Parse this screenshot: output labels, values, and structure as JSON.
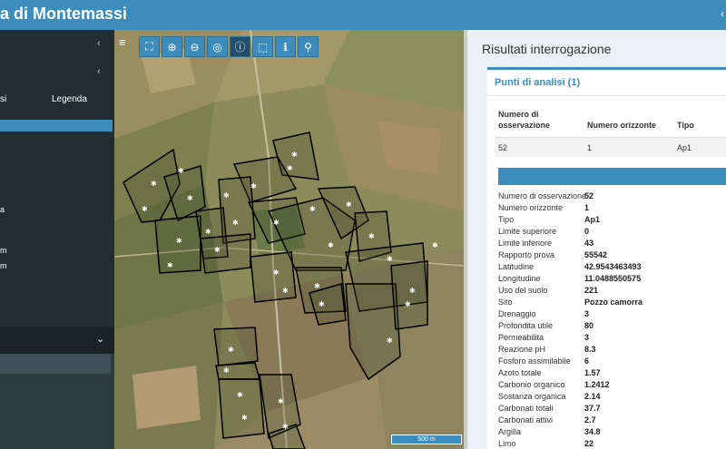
{
  "header": {
    "title": "a di Montemassi",
    "ctrl": "‹"
  },
  "sidebar": {
    "tab_left": "si",
    "tab_right": "Legenda",
    "items": [
      "a",
      "m",
      "m"
    ]
  },
  "toolbar": {
    "menu_icon": "hamburger-icon",
    "tools": [
      {
        "name": "fullscreen-icon",
        "glyph": "⛶"
      },
      {
        "name": "zoom-in-icon",
        "glyph": "⊕"
      },
      {
        "name": "zoom-out-icon",
        "glyph": "⊖"
      },
      {
        "name": "zoom-extent-icon",
        "glyph": "◎"
      },
      {
        "name": "info-icon",
        "glyph": "ⓘ"
      },
      {
        "name": "select-box-icon",
        "glyph": "⬚"
      },
      {
        "name": "identify-icon",
        "glyph": "ℹ"
      },
      {
        "name": "locate-user-icon",
        "glyph": "⚲"
      }
    ]
  },
  "map": {
    "scale_label": "500 m"
  },
  "results": {
    "title": "Risultati interrogazione",
    "box_title": "Punti di analisi (1)",
    "columns": [
      "Numero di osservazione",
      "Numero orizzonte",
      "Tipo"
    ],
    "row": [
      "52",
      "1",
      "Ap1"
    ],
    "attributes": [
      {
        "key": "Numero di osservazione",
        "value": "52"
      },
      {
        "key": "Numero orizzonte",
        "value": "1"
      },
      {
        "key": "Tipo",
        "value": "Ap1"
      },
      {
        "key": "Limite superiore",
        "value": "0"
      },
      {
        "key": "Limite inferiore",
        "value": "43"
      },
      {
        "key": "Rapporto prova",
        "value": "55542"
      },
      {
        "key": "Latitudine",
        "value": "42.9543463493"
      },
      {
        "key": "Longitudine",
        "value": "11.0488550575"
      },
      {
        "key": "Uso del suolo",
        "value": "221"
      },
      {
        "key": "Sito",
        "value": "Pozzo camorra"
      },
      {
        "key": "Drenaggio",
        "value": "3"
      },
      {
        "key": "Profondita utile",
        "value": "80"
      },
      {
        "key": "Permeabilita",
        "value": "3"
      },
      {
        "key": "Reazione pH",
        "value": "8.3"
      },
      {
        "key": "Fosforo assimilabile",
        "value": "6"
      },
      {
        "key": "Azoto totale",
        "value": "1.57"
      },
      {
        "key": "Carbonio organico",
        "value": "1.2412"
      },
      {
        "key": "Sostanza organica",
        "value": "2.14"
      },
      {
        "key": "Carbonati totali",
        "value": "37.7"
      },
      {
        "key": "Carbonati attivi",
        "value": "2.7"
      },
      {
        "key": "Argilla",
        "value": "34.8"
      },
      {
        "key": "Limo",
        "value": "22"
      }
    ]
  }
}
